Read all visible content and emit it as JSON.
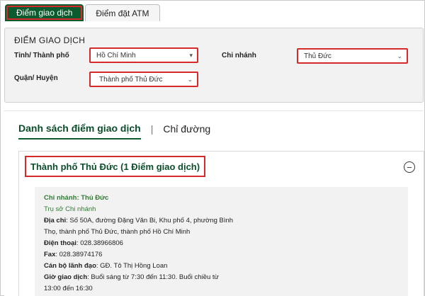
{
  "tabs": [
    {
      "label": "Điểm giao dịch"
    },
    {
      "label": "Điểm đặt ATM"
    }
  ],
  "filter": {
    "title": "ĐIỂM GIAO DỊCH",
    "province_label": "Tỉnh/ Thành phố",
    "province_value": "Hồ Chí Minh",
    "branch_label": "Chi nhánh",
    "branch_value": "Thủ Đức",
    "district_label": "Quận/ Huyện",
    "district_value": "Thành phố Thủ Đức"
  },
  "view_tabs": {
    "list": "Danh sách điểm giao dịch",
    "separator": "|",
    "directions": "Chỉ đường"
  },
  "group": {
    "title": "Thành phố Thủ Đức (1 Điểm giao dịch)",
    "toggle": "−"
  },
  "location": {
    "branch": "Chi nhánh: Thủ Đức",
    "type": "Trụ sở Chi nhánh",
    "address_label": "Địa chỉ",
    "address_line1": ": Số 50A, đường Đặng Văn Bi, Khu phố 4, phường Bình",
    "address_line2": "Thọ, thành phố Thủ Đức, thành phố Hồ Chí Minh",
    "phone_label": "Điện thoại",
    "phone": ": 028.38966806",
    "fax_label": "Fax",
    "fax": ": 028.38974176",
    "manager_label": "Cán bộ lãnh đạo",
    "manager": ": GĐ. Tô Thị Hồng Loan",
    "hours_label": "Giờ giao dịch",
    "hours_line1": ": Buổi sáng từ 7:30 đến 11:30. Buổi chiều từ",
    "hours_line2": "13:00 đến 16:30"
  },
  "colors": {
    "brand_green": "#0c5b2f",
    "highlight_red": "#d42a2a",
    "branch_green": "#2e7d32"
  }
}
